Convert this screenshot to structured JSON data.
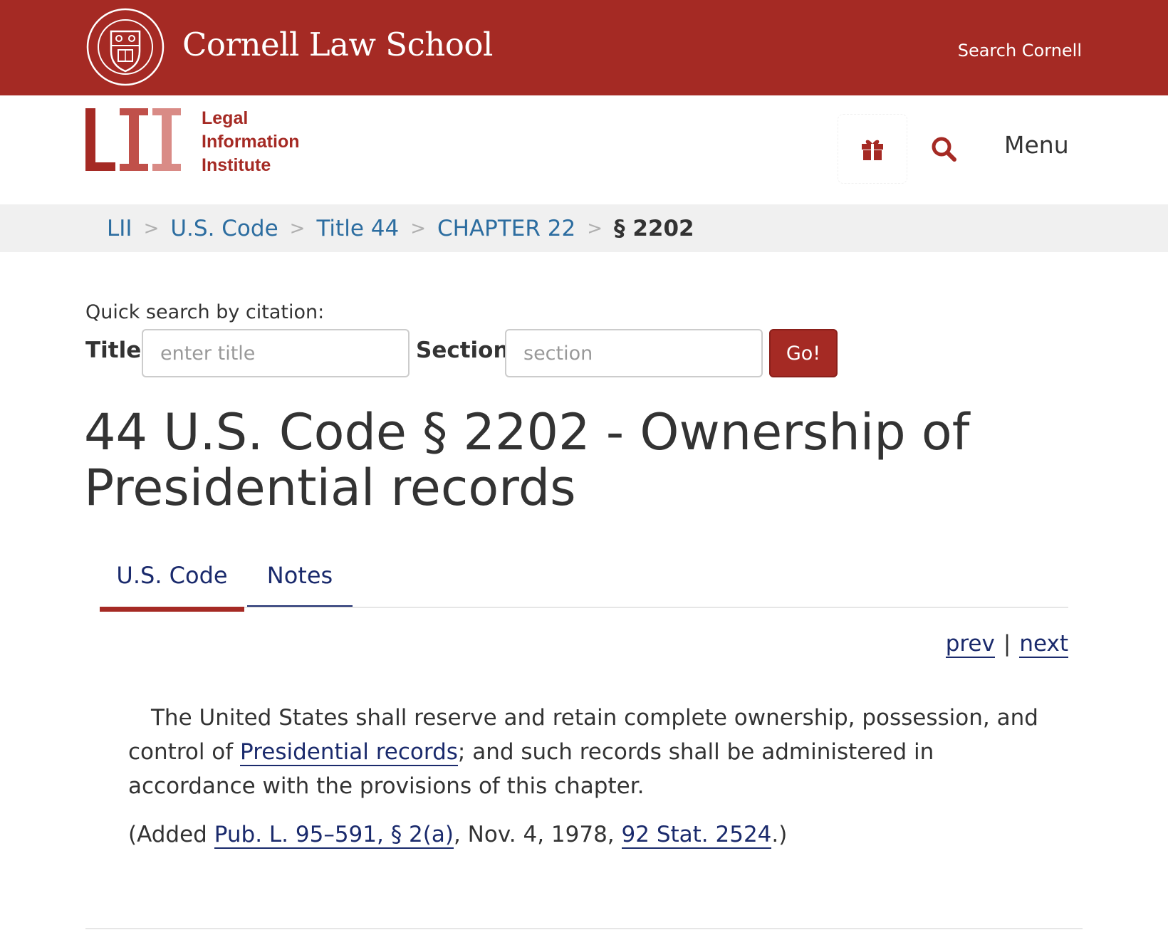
{
  "cornell_header": {
    "title": "Cornell Law School",
    "search_link": "Search Cornell"
  },
  "lii_header": {
    "logo_lines": [
      "Legal",
      "Information",
      "Institute"
    ],
    "menu_label": "Menu"
  },
  "breadcrumb": {
    "items": [
      "LII",
      "U.S. Code",
      "Title 44",
      "CHAPTER 22"
    ],
    "separator": ">",
    "current": "§ 2202"
  },
  "quick_search": {
    "label": "Quick search by citation:",
    "title_label": "Title",
    "title_placeholder": "enter title",
    "section_label": "Section",
    "section_placeholder": "section",
    "go_label": "Go!"
  },
  "page_title": "44 U.S. Code § 2202 - Ownership of Presidential records",
  "tabs": [
    {
      "label": "U.S. Code",
      "active": true
    },
    {
      "label": "Notes",
      "active": false
    }
  ],
  "pager": {
    "prev": "prev",
    "separator": "|",
    "next": "next"
  },
  "content": {
    "para1_before": "The United States shall reserve and retain complete ownership, possession, and control of ",
    "para1_link": "Presidential records",
    "para1_after": "; and such records shall be administered in accordance with the provisions of this chapter.",
    "source_before": "(Added ",
    "source_link1": "Pub. L. 95–591, § 2(a)",
    "source_middle": ", Nov. 4, 1978, ",
    "source_link2": "92 Stat. 2524",
    "source_after": ".)"
  },
  "colors": {
    "cornell_red": "#a52a24",
    "link_blue": "#2c6da0",
    "navy": "#1a2a6c"
  }
}
